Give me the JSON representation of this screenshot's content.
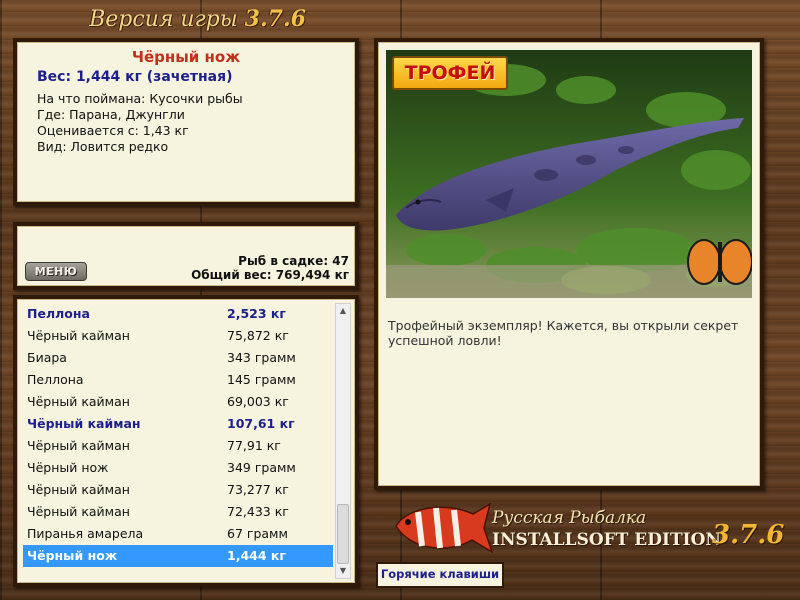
{
  "header": {
    "title_prefix": "Версия игры",
    "version": "3.7.6"
  },
  "catch": {
    "name": "Чёрный нож",
    "weight_line": "Вес: 1,444 кг (зачетная)",
    "lines": [
      "На что поймана: Кусочки рыбы",
      "Где: Парана, Джунгли",
      "Оценивается с: 1,43 кг",
      "Вид: Ловится редко"
    ]
  },
  "menu_button": {
    "label": "МЕНЮ"
  },
  "stats": {
    "fish_count": "Рыб в садке: 47",
    "total_weight": "Общий вес: 769,494 кг"
  },
  "fish_list": [
    {
      "name": "Пеллона",
      "weight": "2,523 кг",
      "style": "bold"
    },
    {
      "name": "Чёрный кайман",
      "weight": "75,872 кг",
      "style": ""
    },
    {
      "name": "Биара",
      "weight": "343 грамм",
      "style": ""
    },
    {
      "name": "Пеллона",
      "weight": "145 грамм",
      "style": ""
    },
    {
      "name": "Чёрный кайман",
      "weight": "69,003 кг",
      "style": ""
    },
    {
      "name": "Чёрный кайман",
      "weight": "107,61 кг",
      "style": "bold"
    },
    {
      "name": "Чёрный кайман",
      "weight": "77,91 кг",
      "style": ""
    },
    {
      "name": "Чёрный нож",
      "weight": "349 грамм",
      "style": ""
    },
    {
      "name": "Чёрный кайман",
      "weight": "73,277 кг",
      "style": ""
    },
    {
      "name": "Чёрный кайман",
      "weight": "72,433 кг",
      "style": ""
    },
    {
      "name": "Пиранья амарела",
      "weight": "67 грамм",
      "style": ""
    },
    {
      "name": "Чёрный нож",
      "weight": "1,444 кг",
      "style": "sel"
    }
  ],
  "trophy": {
    "badge": "ТРОФЕЙ",
    "description": "Трофейный экземпляр! Кажется, вы открыли секрет успешной ловли!"
  },
  "edition": {
    "line1": "Русская Рыбалка",
    "line2": "INSTALLSOFT EDITION",
    "version": "3.7.6"
  },
  "hotkeys": {
    "label": "Горячие клавиши"
  },
  "colors": {
    "accent_red": "#c0301c",
    "accent_blue": "#1d1f8a",
    "selection": "#3399ff",
    "panel_bg": "#f6f3de"
  },
  "icons": {
    "scroll_up": "triangle-up",
    "scroll_down": "triangle-down"
  }
}
